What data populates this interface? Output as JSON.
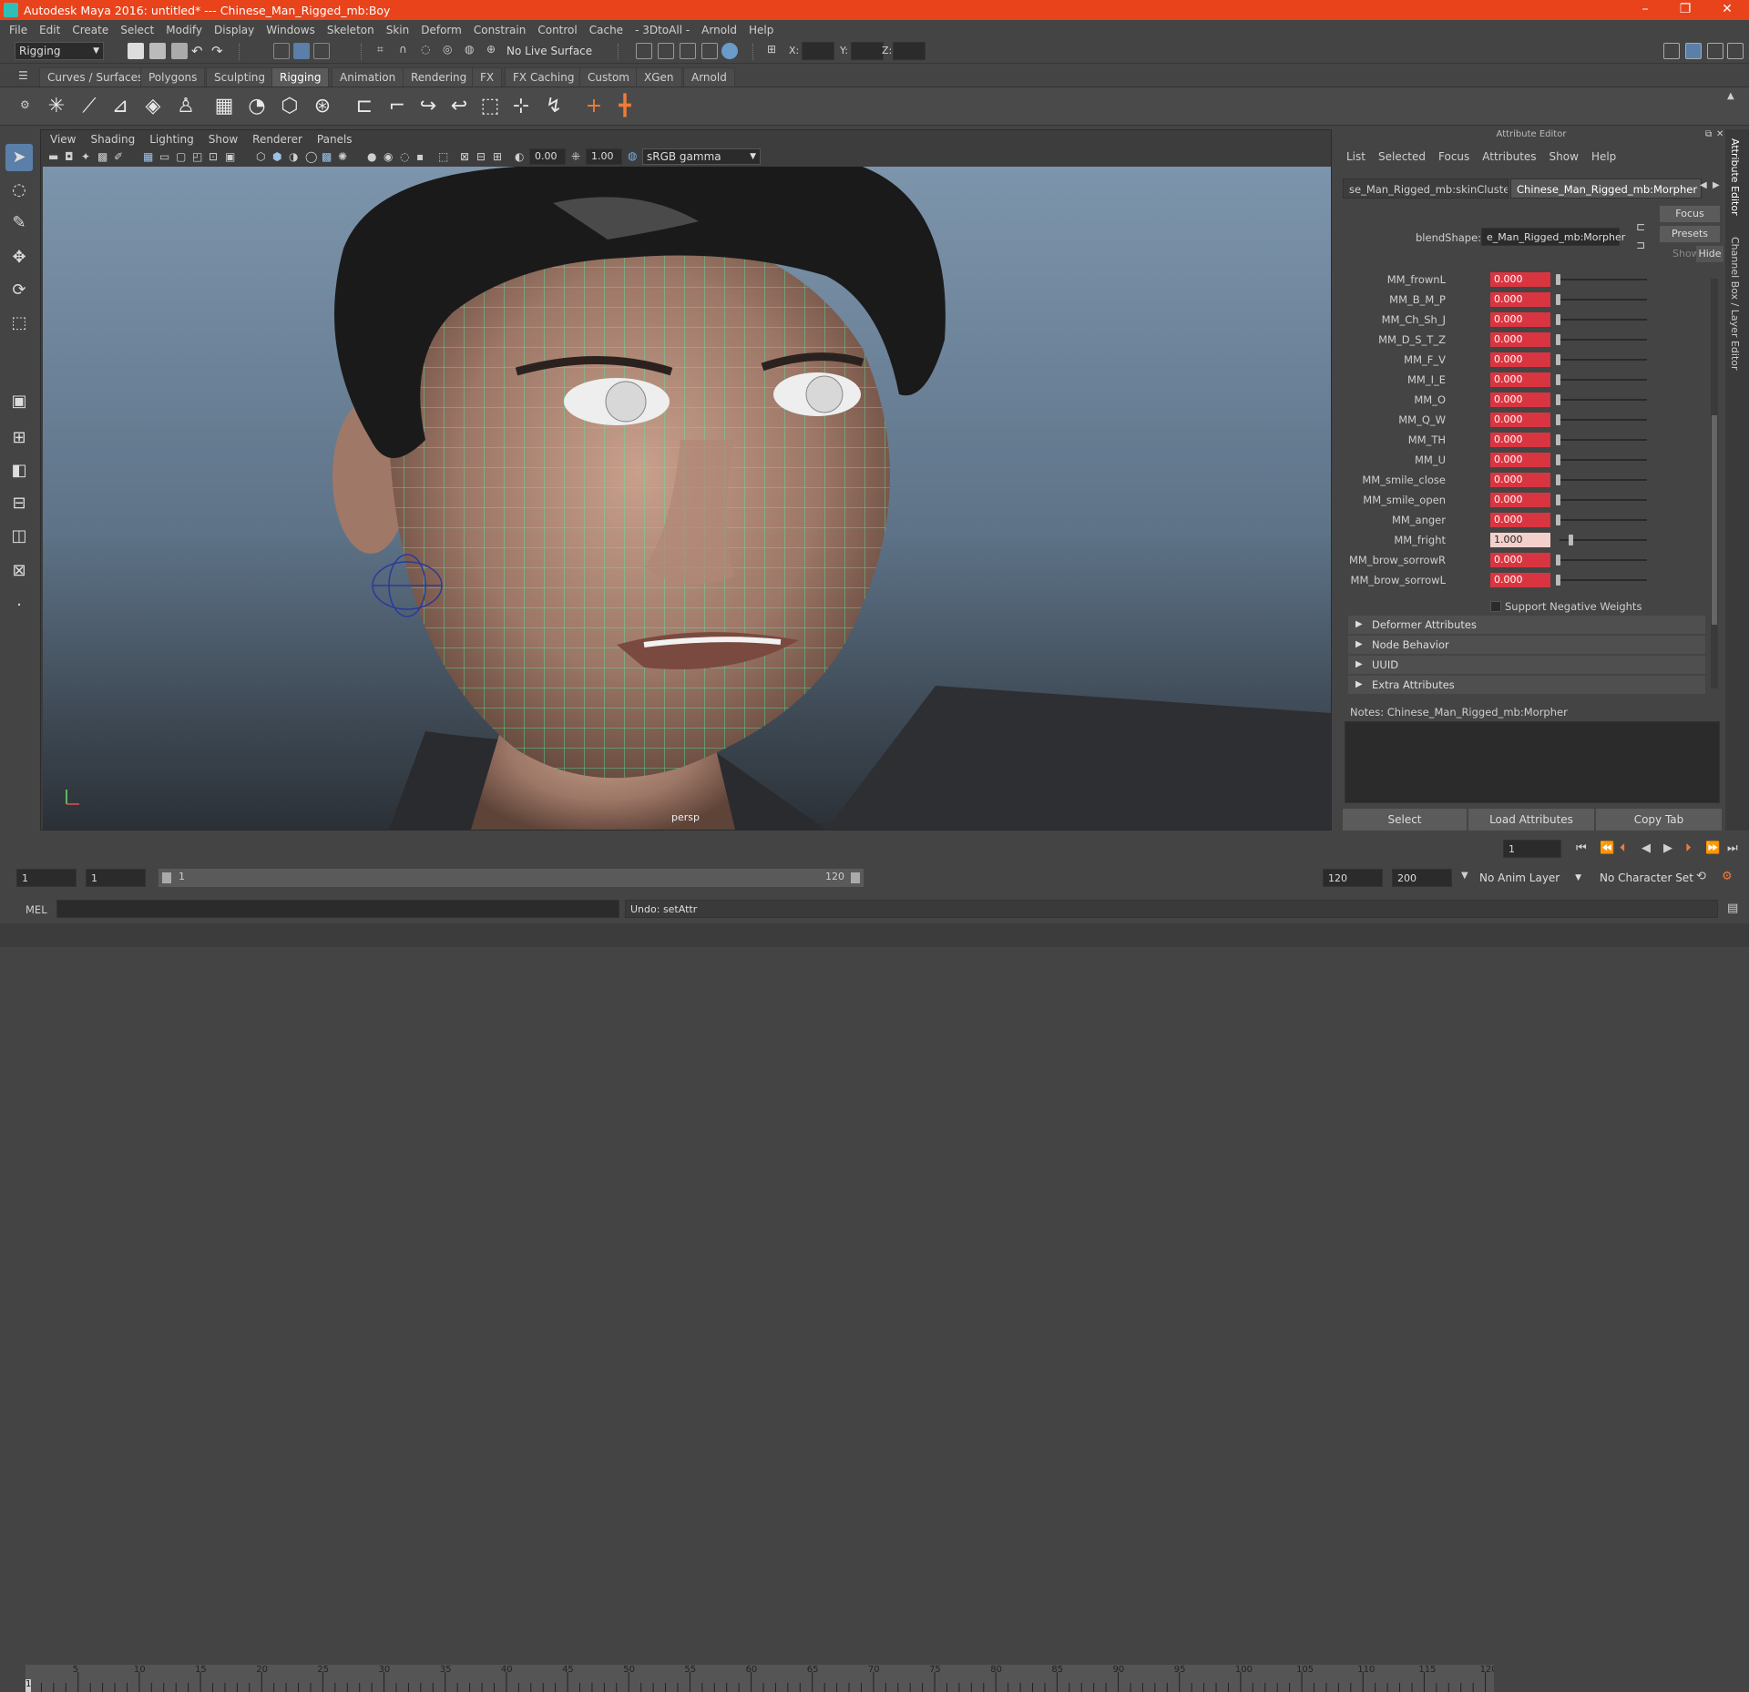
{
  "window": {
    "title": "Autodesk Maya 2016: untitled*   ---   Chinese_Man_Rigged_mb:Boy",
    "min": "–",
    "max": "❐",
    "close": "✕"
  },
  "menu": [
    "File",
    "Edit",
    "Create",
    "Select",
    "Modify",
    "Display",
    "Windows",
    "Skeleton",
    "Skin",
    "Deform",
    "Constrain",
    "Control",
    "Cache",
    "- 3DtoAll -",
    "Arnold",
    "Help"
  ],
  "toolbar": {
    "mode": "Rigging",
    "live_surface": "No Live Surface",
    "x_label": "X:",
    "y_label": "Y:",
    "z_label": "Z:"
  },
  "shelf_tabs": [
    "Curves / Surfaces",
    "Polygons",
    "Sculpting",
    "Rigging",
    "Animation",
    "Rendering",
    "FX",
    "FX Caching",
    "Custom",
    "XGen",
    "Arnold"
  ],
  "shelf_active": "Rigging",
  "panel": {
    "menu": [
      "View",
      "Shading",
      "Lighting",
      "Show",
      "Renderer",
      "Panels"
    ],
    "exposure": "0.00",
    "gamma": "1.00",
    "colorspace": "sRGB gamma",
    "camera_label": "persp"
  },
  "attribute_editor": {
    "header": "Attribute Editor",
    "menu": [
      "List",
      "Selected",
      "Focus",
      "Attributes",
      "Show",
      "Help"
    ],
    "tabs": [
      "se_Man_Rigged_mb:skinCluster1",
      "Chinese_Man_Rigged_mb:Morpher"
    ],
    "blendshape_label": "blendShape:",
    "blendshape_value": "e_Man_Rigged_mb:Morpher",
    "focus_btn": "Focus",
    "presets_btn": "Presets",
    "show_label": "Show",
    "hide_btn": "Hide",
    "weights": [
      {
        "name": "MM_frownL",
        "value": "0.000",
        "level": 0
      },
      {
        "name": "MM_B_M_P",
        "value": "0.000",
        "level": 0
      },
      {
        "name": "MM_Ch_Sh_J",
        "value": "0.000",
        "level": 0
      },
      {
        "name": "MM_D_S_T_Z",
        "value": "0.000",
        "level": 0
      },
      {
        "name": "MM_F_V",
        "value": "0.000",
        "level": 0
      },
      {
        "name": "MM_I_E",
        "value": "0.000",
        "level": 0
      },
      {
        "name": "MM_O",
        "value": "0.000",
        "level": 0
      },
      {
        "name": "MM_Q_W",
        "value": "0.000",
        "level": 0
      },
      {
        "name": "MM_TH",
        "value": "0.000",
        "level": 0
      },
      {
        "name": "MM_U",
        "value": "0.000",
        "level": 0
      },
      {
        "name": "MM_smile_close",
        "value": "0.000",
        "level": 0
      },
      {
        "name": "MM_smile_open",
        "value": "0.000",
        "level": 0
      },
      {
        "name": "MM_anger",
        "value": "0.000",
        "level": 0
      },
      {
        "name": "MM_fright",
        "value": "1.000",
        "level": 1
      },
      {
        "name": "MM_brow_sorrowR",
        "value": "0.000",
        "level": 0
      },
      {
        "name": "MM_brow_sorrowL",
        "value": "0.000",
        "level": 0
      }
    ],
    "support_negative": "Support Negative Weights",
    "sections": [
      "Deformer Attributes",
      "Node Behavior",
      "UUID",
      "Extra Attributes"
    ],
    "notes_label": "Notes:  Chinese_Man_Rigged_mb:Morpher",
    "buttons": [
      "Select",
      "Load Attributes",
      "Copy Tab"
    ]
  },
  "side_tabs": [
    "Attribute Editor",
    "Channel Box / Layer Editor"
  ],
  "timeline": {
    "ticks": [
      "5",
      "10",
      "15",
      "20",
      "25",
      "30",
      "35",
      "40",
      "45",
      "50",
      "55",
      "60",
      "65",
      "70",
      "75",
      "80",
      "85",
      "90",
      "95",
      "100",
      "105",
      "110",
      "115",
      "120"
    ],
    "first": "1",
    "current_frame": "1"
  },
  "range": {
    "start": "1",
    "anim_start": "1",
    "slider_start": "1",
    "slider_end": "120",
    "end": "120",
    "anim_end": "200",
    "anim_layer": "No Anim Layer",
    "char_set": "No Character Set"
  },
  "command": {
    "label": "MEL",
    "result": "Undo: setAttr"
  }
}
